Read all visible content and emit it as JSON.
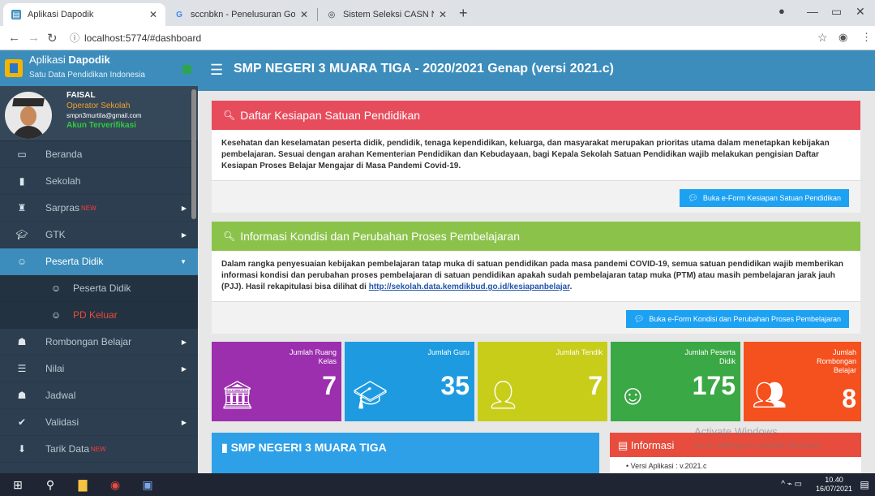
{
  "browser": {
    "tabs": [
      {
        "title": "Aplikasi Dapodik",
        "icon": "dapodik-favicon"
      },
      {
        "title": "sccnbkn - Penelusuran Google",
        "icon": "google-favicon"
      },
      {
        "title": "Sistem Seleksi CASN Nasional",
        "icon": "globe-favicon"
      }
    ],
    "url": "localhost:5774/#dashboard"
  },
  "sidebar": {
    "brand_prefix": "Aplikasi ",
    "brand_bold": "Dapodik",
    "brand_sub": "Satu Data Pendidikan Indonesia",
    "user": {
      "name": "FAISAL",
      "role": "Operator Sekolah",
      "email": "smpn3murtila@gmail.com",
      "status": "Akun Terverifikasi"
    },
    "items": [
      {
        "label": "Beranda",
        "icon": "monitor-icon"
      },
      {
        "label": "Sekolah",
        "icon": "book-icon"
      },
      {
        "label": "Sarpras",
        "icon": "binoculars-icon",
        "badge": "NEW"
      },
      {
        "label": "GTK",
        "icon": "graduation-cap-icon"
      },
      {
        "label": "Peserta Didik",
        "icon": "smile-icon"
      },
      {
        "label": "Peserta Didik",
        "icon": "smile-icon"
      },
      {
        "label": "PD Keluar",
        "icon": "smile-icon"
      },
      {
        "label": "Rombongan Belajar",
        "icon": "users-icon"
      },
      {
        "label": "Nilai",
        "icon": "list-icon"
      },
      {
        "label": "Jadwal",
        "icon": "users-icon"
      },
      {
        "label": "Validasi",
        "icon": "check-icon"
      },
      {
        "label": "Tarik Data",
        "icon": "arrow-down-icon",
        "badge": "NEW"
      }
    ]
  },
  "header": {
    "title": "SMP NEGERI 3 MUARA TIGA - 2020/2021 Genap (versi 2021.c)"
  },
  "kesiapan": {
    "title": "Daftar Kesiapan Satuan Pendidikan",
    "body": "Kesehatan dan keselamatan peserta didik, pendidik, tenaga kependidikan, keluarga, dan masyarakat merupakan prioritas utama dalam menetapkan kebijakan pembelajaran. Sesuai dengan arahan Kementerian Pendidikan dan Kebudayaan, bagi Kepala Sekolah Satuan Pendidikan wajib melakukan pengisian Daftar Kesiapan Proses Belajar Mengajar di Masa Pandemi Covid-19.",
    "button": "Buka e-Form Kesiapan Satuan Pendidikan"
  },
  "kondisi": {
    "title": "Informasi Kondisi dan Perubahan Proses Pembelajaran",
    "body": "Dalam rangka penyesuaian kebijakan pembelajaran tatap muka di satuan pendidikan pada masa pandemi COVID-19, semua satuan pendidikan wajib memberikan informasi kondisi dan perubahan proses pembelajaran di satuan pendidikan apakah sudah pembelajaran tatap muka (PTM) atau masih pembelajaran jarak jauh (PJJ). Hasil rekapitulasi bisa dilihat di ",
    "link": "http://sekolah.data.kemdikbud.go.id/kesiapanbelajar",
    "button": "Buka e-Form Kondisi dan Perubahan Proses Pembelajaran"
  },
  "stats": [
    {
      "label": "Jumlah Ruang Kelas",
      "value": "7",
      "color": "#9b2fae",
      "icon": "institution-icon"
    },
    {
      "label": "Jumlah Guru",
      "value": "35",
      "color": "#1e9be0",
      "icon": "graduation-cap-icon"
    },
    {
      "label": "Jumlah Tendik",
      "value": "7",
      "color": "#c8cd1a",
      "icon": "user-icon"
    },
    {
      "label": "Jumlah Peserta Didik",
      "value": "175",
      "color": "#3aa845",
      "icon": "smile-icon"
    },
    {
      "label": "Jumlah Rombongan Belajar",
      "value": "8",
      "color": "#f4511e",
      "icon": "users-icon"
    }
  ],
  "school_panel": {
    "title": "SMP NEGERI 3 MUARA TIGA"
  },
  "info_panel": {
    "title": "Informasi",
    "line": "Versi Aplikasi : v.2021.c"
  },
  "watermark": {
    "title": "Activate Windows",
    "sub": "Go to Settings to activate Windows."
  },
  "taskbar": {
    "time": "10.40",
    "date": "16/07/2021"
  },
  "colors": {
    "header": "#3c8dbc",
    "sidebar": "#2c3e50",
    "red": "#e74c3c",
    "green": "#8bc34a"
  }
}
